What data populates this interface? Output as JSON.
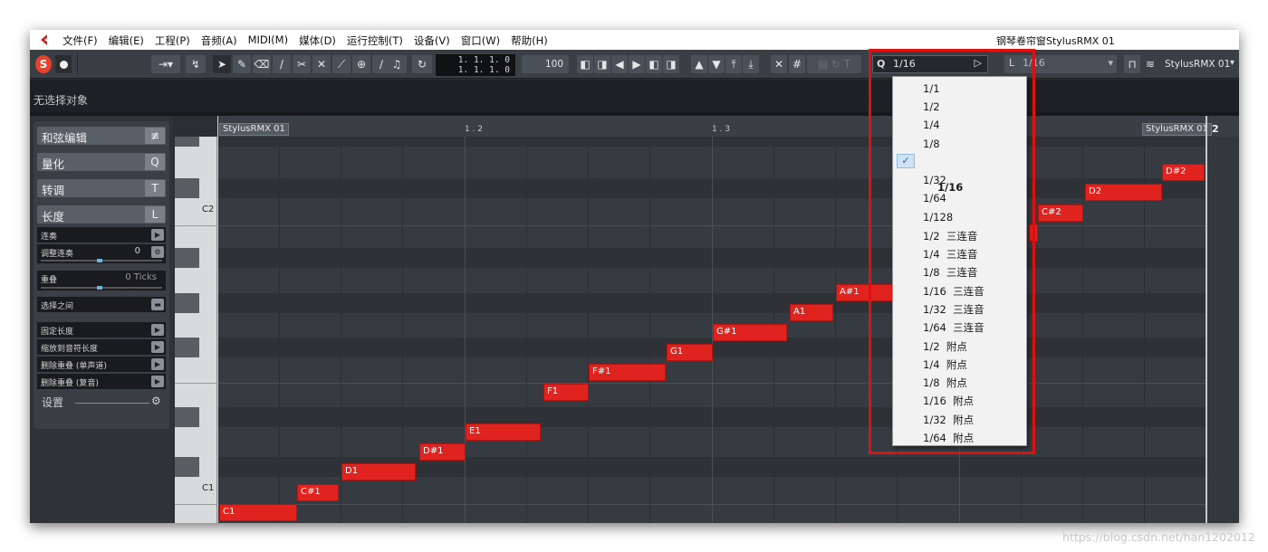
{
  "menu": {
    "items": [
      "文件(F)",
      "编辑(E)",
      "工程(P)",
      "音频(A)",
      "MIDI(M)",
      "媒体(D)",
      "运行控制(T)",
      "设备(V)",
      "窗口(W)",
      "帮助(H)"
    ],
    "window_title": "钢琴卷帘窗StylusRMX 01"
  },
  "toolbar": {
    "solo_label": "S",
    "time_top": "1. 1. 1.   0",
    "time_bottom": "1. 1. 1.   0",
    "velocity": "100",
    "quantize_letter": "Q",
    "quantize_value": "1/16",
    "length_letter": "L",
    "length_value": "1/16",
    "instrument": "StylusRMX 01"
  },
  "info_line": "无选择对象",
  "inspector": {
    "sections": [
      {
        "label": "和弦编辑",
        "icon": "chord-icon"
      },
      {
        "label": "量化",
        "icon": "Q"
      },
      {
        "label": "转调",
        "icon": "T"
      },
      {
        "label": "长度",
        "icon": "L"
      }
    ],
    "rows": [
      {
        "label": "连奏"
      },
      {
        "label": "调整连奏",
        "value": "0"
      },
      {
        "label": "重叠",
        "value": "0 Ticks"
      },
      {
        "label": "选择之间"
      },
      {
        "label": "固定长度"
      },
      {
        "label": "缩放到音符长度"
      },
      {
        "label": "删除重叠 (单声道)"
      },
      {
        "label": "删除重叠 (复音)"
      }
    ],
    "settings_label": "设置"
  },
  "ruler": {
    "track_name": "StylusRMX 01",
    "marks": [
      "1 . 2",
      "1 . 3"
    ],
    "end_track_name": "StylusRMX 01",
    "end_bar": "2"
  },
  "keyboard": {
    "labels": [
      "C2",
      "C1"
    ]
  },
  "notes": [
    "C1",
    "C#1",
    "D1",
    "D#1",
    "E1",
    "F1",
    "F#1",
    "G1",
    "G#1",
    "A1",
    "A#1",
    "C#2",
    "D2",
    "D#2"
  ],
  "quantize_dropdown": {
    "options": [
      "1/1",
      "1/2",
      "1/4",
      "1/8",
      "1/16",
      "1/32",
      "1/64",
      "1/128",
      "1/2  三连音",
      "1/4  三连音",
      "1/8  三连音",
      "1/16  三连音",
      "1/32  三连音",
      "1/64  三连音",
      "1/2  附点",
      "1/4  附点",
      "1/8  附点",
      "1/16  附点",
      "1/32  附点",
      "1/64  附点"
    ],
    "selected": "1/16",
    "check": "✓"
  },
  "watermark": "https://blog.csdn.net/han1202012",
  "colors": {
    "note": "#e0231f",
    "highlight": "#e01010",
    "solo": "#e8402a"
  }
}
